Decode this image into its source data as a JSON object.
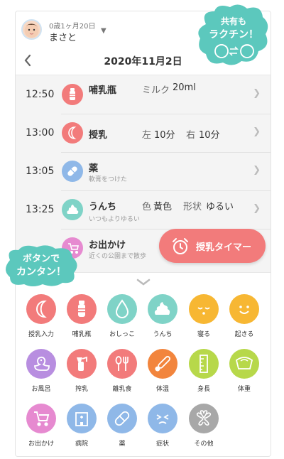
{
  "header": {
    "age": "0歳1ヶ月20日",
    "child_name": "まさと"
  },
  "date_bar": {
    "date": "2020年11月2日"
  },
  "records": [
    {
      "time": "12:50",
      "icon": "baby-bottle-icon",
      "color": "#f27b7b",
      "label": "哺乳瓶",
      "detail_label": "ミルク",
      "detail_value": "20ml",
      "note": ""
    },
    {
      "time": "13:00",
      "icon": "crescent-icon",
      "color": "#f27b7b",
      "label": "授乳",
      "detail_label": "左",
      "detail_value": "10分",
      "detail_label2": "右",
      "detail_value2": "10分",
      "note": ""
    },
    {
      "time": "13:05",
      "icon": "pill-icon",
      "color": "#8fb8e8",
      "label": "薬",
      "note": "軟膏をつけた"
    },
    {
      "time": "13:25",
      "icon": "poop-icon",
      "color": "#7fd3c7",
      "label": "うんち",
      "detail_label": "色",
      "detail_value": "黄色",
      "detail_label2": "形状",
      "detail_value2": "ゆるい",
      "note": "いつもよりゆるい"
    },
    {
      "time": "",
      "icon": "stroller-icon",
      "color": "#e68ad0",
      "label": "お出かけ",
      "note": "近くの公園まで散歩"
    }
  ],
  "timer_button": {
    "label": "授乳タイマー"
  },
  "bubbles": {
    "top_right_line1": "共有も",
    "top_right_line2": "ラクチン！",
    "left_line1": "ボタンで",
    "left_line2": "カンタン！"
  },
  "buttons": [
    {
      "label": "授乳入力",
      "icon": "crescent-icon",
      "color": "#f27b7b"
    },
    {
      "label": "哺乳瓶",
      "icon": "baby-bottle-icon",
      "color": "#f27b7b"
    },
    {
      "label": "おしっこ",
      "icon": "droplet-icon",
      "color": "#7fd3c7"
    },
    {
      "label": "うんち",
      "icon": "poop-icon",
      "color": "#7fd3c7"
    },
    {
      "label": "寝る",
      "icon": "sleeping-face-icon",
      "color": "#f7b733"
    },
    {
      "label": "起きる",
      "icon": "smile-face-icon",
      "color": "#f7b733"
    },
    {
      "label": "お風呂",
      "icon": "duck-icon",
      "color": "#b88ee0"
    },
    {
      "label": "搾乳",
      "icon": "breast-pump-icon",
      "color": "#f27b7b"
    },
    {
      "label": "離乳食",
      "icon": "cutlery-icon",
      "color": "#f27b7b"
    },
    {
      "label": "体温",
      "icon": "thermometer-icon",
      "color": "#f2853d"
    },
    {
      "label": "身長",
      "icon": "ruler-icon",
      "color": "#b7d84a"
    },
    {
      "label": "体重",
      "icon": "scale-icon",
      "color": "#b7d84a"
    },
    {
      "label": "お出かけ",
      "icon": "stroller-icon",
      "color": "#e68ad0"
    },
    {
      "label": "病院",
      "icon": "hospital-icon",
      "color": "#8fb8e8"
    },
    {
      "label": "薬",
      "icon": "pill-icon",
      "color": "#8fb8e8"
    },
    {
      "label": "症状",
      "icon": "sick-face-icon",
      "color": "#8fb8e8"
    },
    {
      "label": "その他",
      "icon": "clover-icon",
      "color": "#a8a8a8"
    }
  ]
}
